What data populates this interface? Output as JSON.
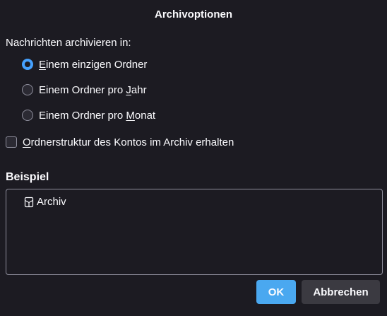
{
  "dialog": {
    "title": "Archivoptionen"
  },
  "archive_granularity": {
    "label": "Nachrichten archivieren in:",
    "options": [
      {
        "prefix": "",
        "accesskey": "E",
        "suffix": "inem einzigen Ordner",
        "checked": true
      },
      {
        "prefix": "Einem Ordner pro ",
        "accesskey": "J",
        "suffix": "ahr",
        "checked": false
      },
      {
        "prefix": "Einem Ordner pro ",
        "accesskey": "M",
        "suffix": "onat",
        "checked": false
      }
    ]
  },
  "keep_structure": {
    "accesskey": "O",
    "suffix": "rdnerstruktur des Kontos im Archiv erhalten",
    "checked": false
  },
  "example": {
    "heading": "Beispiel",
    "tree_item": "Archiv",
    "icon": "archive-box-icon"
  },
  "buttons": {
    "ok": "OK",
    "cancel": "Abbrechen"
  },
  "colors": {
    "background": "#1c1b22",
    "accent": "#4aa8f0",
    "secondary_button": "#3b3a41"
  }
}
